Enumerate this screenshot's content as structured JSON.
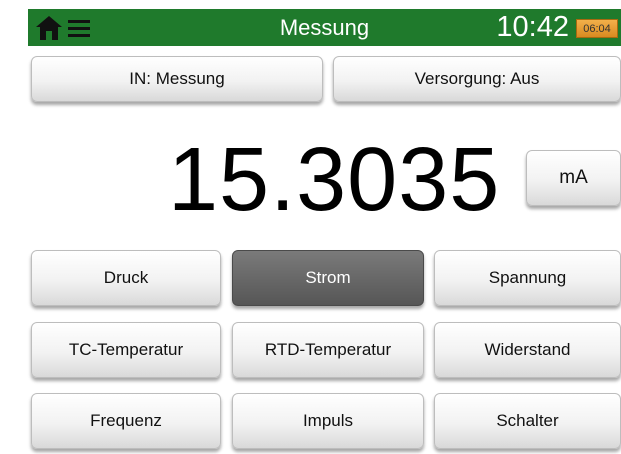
{
  "header": {
    "title": "Messung",
    "time": "10:42",
    "battery": "06:04",
    "home_icon": "home-icon",
    "menu_icon": "hamburger-menu-icon",
    "color": "#1f7a2c"
  },
  "top_buttons": {
    "input": "IN: Messung",
    "supply": "Versorgung: Aus"
  },
  "reading": {
    "value": "15.3035",
    "unit": "mA"
  },
  "quantities": [
    {
      "label": "Druck"
    },
    {
      "label": "Strom",
      "selected": true
    },
    {
      "label": "Spannung"
    },
    {
      "label": "TC-Temperatur"
    },
    {
      "label": "RTD-Temperatur"
    },
    {
      "label": "Widerstand"
    },
    {
      "label": "Frequenz"
    },
    {
      "label": "Impuls"
    },
    {
      "label": "Schalter"
    }
  ]
}
